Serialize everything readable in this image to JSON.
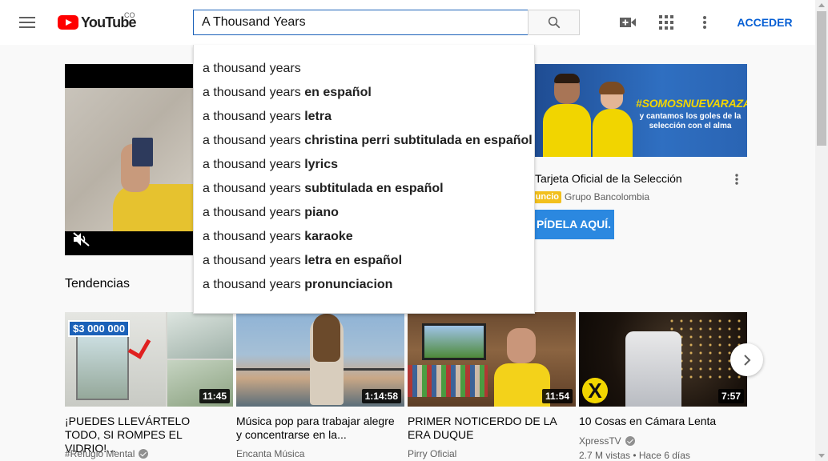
{
  "header": {
    "logo_text": "YouTube",
    "country_code": "CO",
    "search_value": "A Thousand Years",
    "signin_label": "ACCEDER",
    "icons": [
      "menu-icon",
      "search-icon",
      "video-camera-icon",
      "apps-grid-icon",
      "more-vert-icon"
    ]
  },
  "suggestions": {
    "typed": "a thousand years",
    "items": [
      {
        "prefix": "a thousand years",
        "completion": ""
      },
      {
        "prefix": "a thousand years ",
        "completion": "en español"
      },
      {
        "prefix": "a thousand years ",
        "completion": "letra"
      },
      {
        "prefix": "a thousand years ",
        "completion": "christina perri subtitulada en español"
      },
      {
        "prefix": "a thousand years ",
        "completion": "lyrics"
      },
      {
        "prefix": "a thousand years ",
        "completion": "subtitulada en español"
      },
      {
        "prefix": "a thousand years ",
        "completion": "piano"
      },
      {
        "prefix": "a thousand years ",
        "completion": "karaoke"
      },
      {
        "prefix": "a thousand years ",
        "completion": "letra en español"
      },
      {
        "prefix": "a thousand years ",
        "completion": "pronunciacion"
      }
    ]
  },
  "ad": {
    "hashtag": "#SOMOSNUEVARAZA",
    "banner_text": "y cantamos los goles de la selección con el alma",
    "title": "Tarjeta Oficial de la Selección",
    "badge": "uncio",
    "channel": "Grupo Bancolombia",
    "cta": "PÍDELA AQUÍ."
  },
  "trending": {
    "section_title": "Tendencias",
    "videos": [
      {
        "title": "¡PUEDES LLEVÁRTELO TODO, SI ROMPES EL VIDRIO!...",
        "channel": "#Refugio Mental",
        "verified": true,
        "duration": "11:45",
        "thumb_text": "$3 000 000",
        "meta": ""
      },
      {
        "title": "Música pop para trabajar alegre y concentrarse en la...",
        "channel": "Encanta Música",
        "verified": false,
        "duration": "1:14:58",
        "meta": ""
      },
      {
        "title": "PRIMER NOTICERDO DE LA ERA DUQUE",
        "channel": "Pirry Oficial",
        "verified": false,
        "duration": "11:54",
        "meta": ""
      },
      {
        "title": "10 Cosas en Cámara Lenta",
        "channel": "XpressTV",
        "verified": true,
        "duration": "7:57",
        "thumb_text": "X",
        "meta": "2.7 M vistas • Hace 6 días"
      }
    ]
  },
  "colors": {
    "brand_red": "#ff0000",
    "link_blue": "#065fd4",
    "search_border": "#1c62b9",
    "ad_cta": "#2b88e0",
    "ad_badge": "#f2c01d"
  }
}
